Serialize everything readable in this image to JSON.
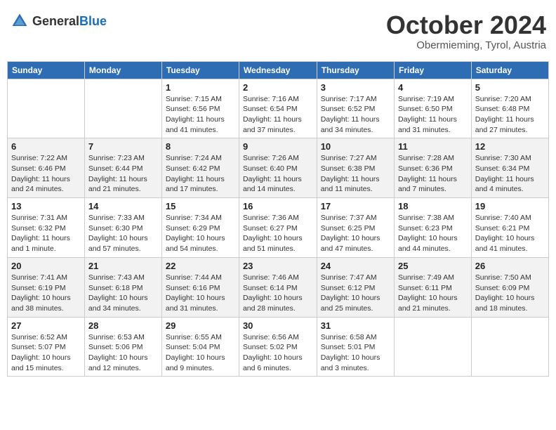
{
  "header": {
    "logo_general": "General",
    "logo_blue": "Blue",
    "month_title": "October 2024",
    "subtitle": "Obermieming, Tyrol, Austria"
  },
  "days_of_week": [
    "Sunday",
    "Monday",
    "Tuesday",
    "Wednesday",
    "Thursday",
    "Friday",
    "Saturday"
  ],
  "weeks": [
    [
      {
        "day": "",
        "info": ""
      },
      {
        "day": "",
        "info": ""
      },
      {
        "day": "1",
        "info": "Sunrise: 7:15 AM\nSunset: 6:56 PM\nDaylight: 11 hours and 41 minutes."
      },
      {
        "day": "2",
        "info": "Sunrise: 7:16 AM\nSunset: 6:54 PM\nDaylight: 11 hours and 37 minutes."
      },
      {
        "day": "3",
        "info": "Sunrise: 7:17 AM\nSunset: 6:52 PM\nDaylight: 11 hours and 34 minutes."
      },
      {
        "day": "4",
        "info": "Sunrise: 7:19 AM\nSunset: 6:50 PM\nDaylight: 11 hours and 31 minutes."
      },
      {
        "day": "5",
        "info": "Sunrise: 7:20 AM\nSunset: 6:48 PM\nDaylight: 11 hours and 27 minutes."
      }
    ],
    [
      {
        "day": "6",
        "info": "Sunrise: 7:22 AM\nSunset: 6:46 PM\nDaylight: 11 hours and 24 minutes."
      },
      {
        "day": "7",
        "info": "Sunrise: 7:23 AM\nSunset: 6:44 PM\nDaylight: 11 hours and 21 minutes."
      },
      {
        "day": "8",
        "info": "Sunrise: 7:24 AM\nSunset: 6:42 PM\nDaylight: 11 hours and 17 minutes."
      },
      {
        "day": "9",
        "info": "Sunrise: 7:26 AM\nSunset: 6:40 PM\nDaylight: 11 hours and 14 minutes."
      },
      {
        "day": "10",
        "info": "Sunrise: 7:27 AM\nSunset: 6:38 PM\nDaylight: 11 hours and 11 minutes."
      },
      {
        "day": "11",
        "info": "Sunrise: 7:28 AM\nSunset: 6:36 PM\nDaylight: 11 hours and 7 minutes."
      },
      {
        "day": "12",
        "info": "Sunrise: 7:30 AM\nSunset: 6:34 PM\nDaylight: 11 hours and 4 minutes."
      }
    ],
    [
      {
        "day": "13",
        "info": "Sunrise: 7:31 AM\nSunset: 6:32 PM\nDaylight: 11 hours and 1 minute."
      },
      {
        "day": "14",
        "info": "Sunrise: 7:33 AM\nSunset: 6:30 PM\nDaylight: 10 hours and 57 minutes."
      },
      {
        "day": "15",
        "info": "Sunrise: 7:34 AM\nSunset: 6:29 PM\nDaylight: 10 hours and 54 minutes."
      },
      {
        "day": "16",
        "info": "Sunrise: 7:36 AM\nSunset: 6:27 PM\nDaylight: 10 hours and 51 minutes."
      },
      {
        "day": "17",
        "info": "Sunrise: 7:37 AM\nSunset: 6:25 PM\nDaylight: 10 hours and 47 minutes."
      },
      {
        "day": "18",
        "info": "Sunrise: 7:38 AM\nSunset: 6:23 PM\nDaylight: 10 hours and 44 minutes."
      },
      {
        "day": "19",
        "info": "Sunrise: 7:40 AM\nSunset: 6:21 PM\nDaylight: 10 hours and 41 minutes."
      }
    ],
    [
      {
        "day": "20",
        "info": "Sunrise: 7:41 AM\nSunset: 6:19 PM\nDaylight: 10 hours and 38 minutes."
      },
      {
        "day": "21",
        "info": "Sunrise: 7:43 AM\nSunset: 6:18 PM\nDaylight: 10 hours and 34 minutes."
      },
      {
        "day": "22",
        "info": "Sunrise: 7:44 AM\nSunset: 6:16 PM\nDaylight: 10 hours and 31 minutes."
      },
      {
        "day": "23",
        "info": "Sunrise: 7:46 AM\nSunset: 6:14 PM\nDaylight: 10 hours and 28 minutes."
      },
      {
        "day": "24",
        "info": "Sunrise: 7:47 AM\nSunset: 6:12 PM\nDaylight: 10 hours and 25 minutes."
      },
      {
        "day": "25",
        "info": "Sunrise: 7:49 AM\nSunset: 6:11 PM\nDaylight: 10 hours and 21 minutes."
      },
      {
        "day": "26",
        "info": "Sunrise: 7:50 AM\nSunset: 6:09 PM\nDaylight: 10 hours and 18 minutes."
      }
    ],
    [
      {
        "day": "27",
        "info": "Sunrise: 6:52 AM\nSunset: 5:07 PM\nDaylight: 10 hours and 15 minutes."
      },
      {
        "day": "28",
        "info": "Sunrise: 6:53 AM\nSunset: 5:06 PM\nDaylight: 10 hours and 12 minutes."
      },
      {
        "day": "29",
        "info": "Sunrise: 6:55 AM\nSunset: 5:04 PM\nDaylight: 10 hours and 9 minutes."
      },
      {
        "day": "30",
        "info": "Sunrise: 6:56 AM\nSunset: 5:02 PM\nDaylight: 10 hours and 6 minutes."
      },
      {
        "day": "31",
        "info": "Sunrise: 6:58 AM\nSunset: 5:01 PM\nDaylight: 10 hours and 3 minutes."
      },
      {
        "day": "",
        "info": ""
      },
      {
        "day": "",
        "info": ""
      }
    ]
  ]
}
